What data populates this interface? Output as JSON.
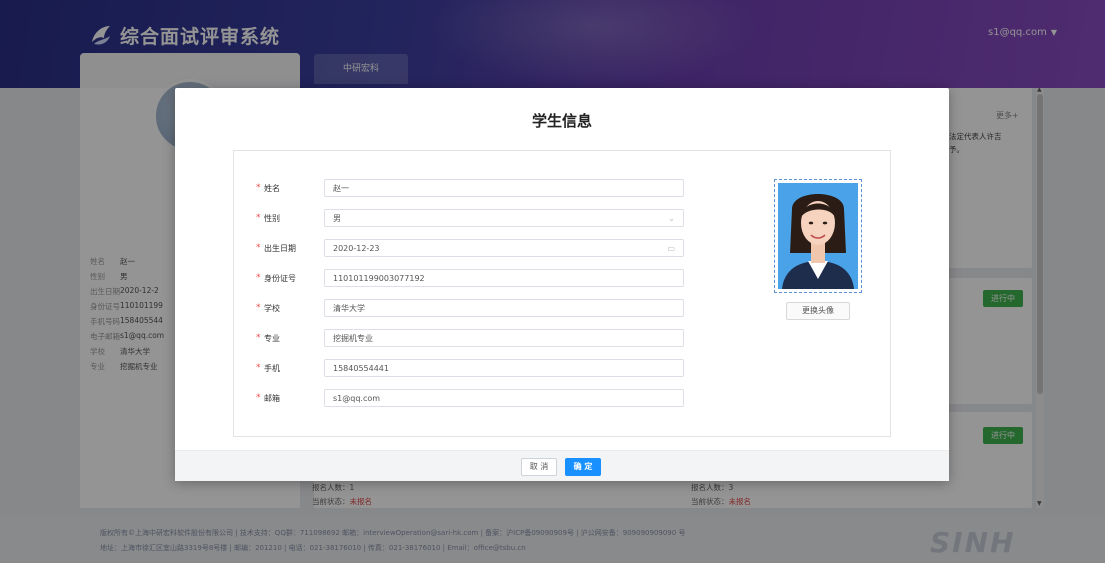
{
  "header": {
    "title": "综合面试评审系统",
    "user_email": "s1@qq.com",
    "tab_label": "中研宏科"
  },
  "left_panel": {
    "info": [
      {
        "label": "姓名",
        "value": "赵一"
      },
      {
        "label": "性别",
        "value": "男"
      },
      {
        "label": "出生日期",
        "value": "2020-12-2"
      },
      {
        "label": "身份证号",
        "value": "110101199"
      },
      {
        "label": "手机号码",
        "value": "158405544"
      },
      {
        "label": "电子邮箱",
        "value": "s1@qq.com"
      },
      {
        "label": "学校",
        "value": "清华大学"
      },
      {
        "label": "专业",
        "value": "挖掘机专业"
      }
    ]
  },
  "cards": {
    "more_link": "更多+",
    "text_line1": "法定代表人许吉",
    "text_line2": "予。",
    "status_1": "进行中",
    "status_2": "进行中",
    "left": {
      "count_text": "报名人数：1",
      "state_label": "当前状态：",
      "state_value": "未报名"
    },
    "right": {
      "count_text": "报名人数：3",
      "state_label": "当前状态：",
      "state_value": "未报名"
    }
  },
  "footer": {
    "line1": "版权所有©上海中研宏科软件股份有限公司 | 技术支持：QQ群：711098692 邮箱：interviewOperation@sari-hk.com | 备案：沪ICP备09090909号 | 沪公网安备：909090909090 号",
    "line2": "地址：上海市徐汇区宜山路3319号8号楼 | 邮编：201210 | 电话：021-38176010 | 传真：021-38176010 | Email：office@tsbu.cn",
    "logo_text": "SINH"
  },
  "modal": {
    "title": "学生信息",
    "fields": [
      {
        "label": "姓名",
        "value": "赵一",
        "suffix": ""
      },
      {
        "label": "性别",
        "value": "男",
        "suffix": "⌄"
      },
      {
        "label": "出生日期",
        "value": "2020-12-23",
        "suffix": "▭"
      },
      {
        "label": "身份证号",
        "value": "110101199003077192",
        "suffix": ""
      },
      {
        "label": "学校",
        "value": "清华大学",
        "suffix": ""
      },
      {
        "label": "专业",
        "value": "挖掘机专业",
        "suffix": ""
      },
      {
        "label": "手机",
        "value": "15840554441",
        "suffix": ""
      },
      {
        "label": "邮箱",
        "value": "s1@qq.com",
        "suffix": ""
      }
    ],
    "required_mark": "*",
    "change_photo": "更换头像",
    "cancel": "取 消",
    "confirm": "确 定"
  },
  "colors": {
    "primary": "#1890ff",
    "status_green": "#3fb34f",
    "required_red": "#f04a4a"
  }
}
